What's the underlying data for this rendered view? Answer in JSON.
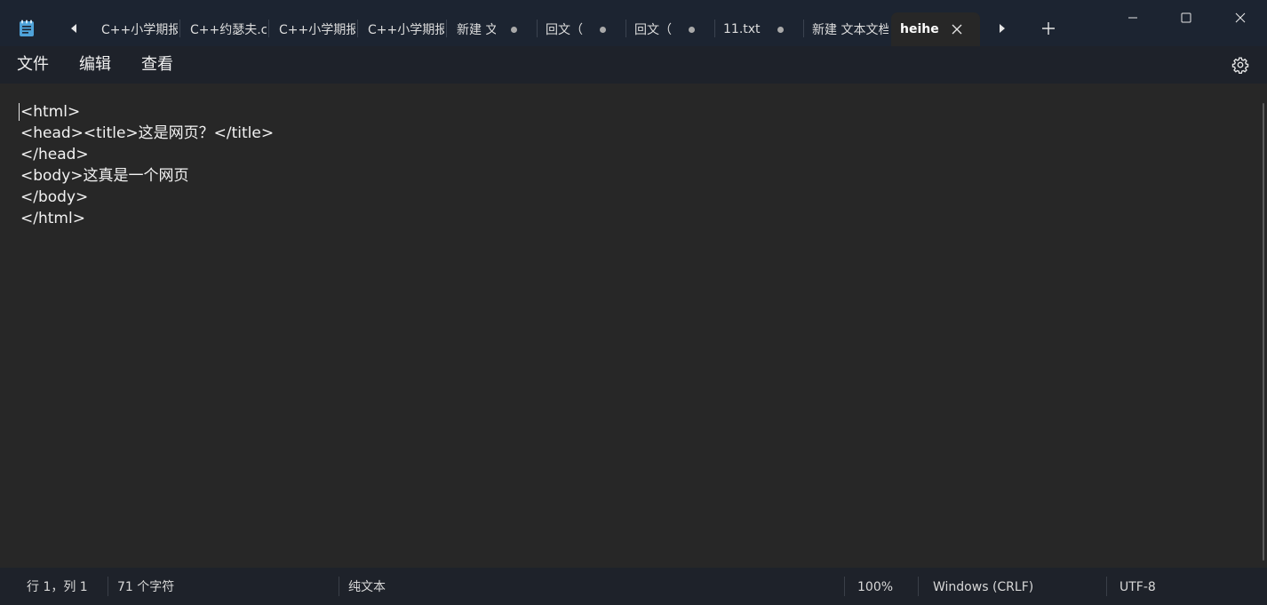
{
  "tabs": [
    {
      "label": "C++小学期报",
      "unsaved": false
    },
    {
      "label": "C++约瑟夫.c",
      "unsaved": false
    },
    {
      "label": "C++小学期报",
      "unsaved": false
    },
    {
      "label": "C++小学期报",
      "unsaved": false
    },
    {
      "label": "新建 文",
      "unsaved": true
    },
    {
      "label": "回文（",
      "unsaved": true
    },
    {
      "label": "回文（",
      "unsaved": true
    },
    {
      "label": "11.txt",
      "unsaved": true
    },
    {
      "label": "新建 文本文档",
      "unsaved": false
    },
    {
      "label": "heihei",
      "active": true
    }
  ],
  "menu": {
    "file": "文件",
    "edit": "编辑",
    "view": "查看"
  },
  "editor": {
    "content": "<html>\n<head><title>这是网页？</title>\n</head>\n<body>这真是一个网页\n</body>\n</html>"
  },
  "status": {
    "position": "行 1，列 1",
    "char_count": "71 个字符",
    "format": "纯文本",
    "zoom": "100%",
    "line_ending": "Windows (CRLF)",
    "encoding": "UTF-8"
  },
  "icons": {
    "app": "notepad-icon",
    "settings": "gear-icon",
    "minimize": "minimize-icon",
    "maximize": "maximize-icon",
    "close": "close-icon"
  },
  "colors": {
    "titlebar": "#1c2431",
    "editor_bg": "#272727",
    "accent_icon": "#4fa3d9"
  }
}
